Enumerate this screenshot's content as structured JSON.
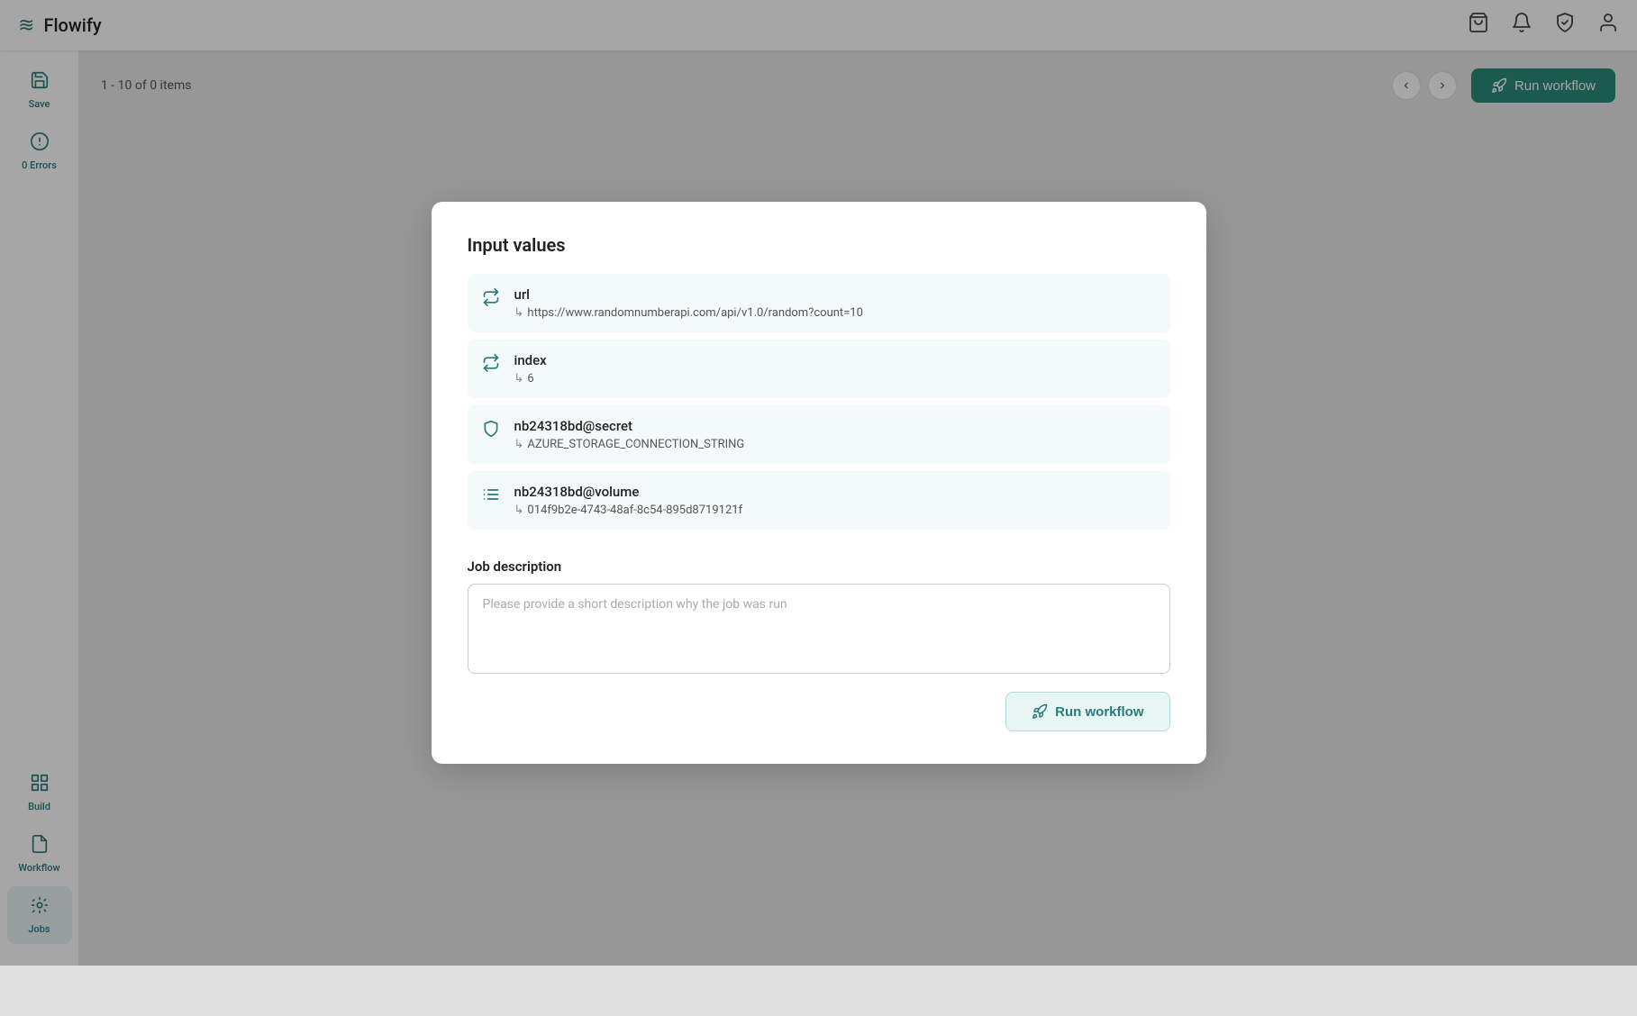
{
  "app": {
    "title": "Flowify"
  },
  "topnav": {
    "logo_icon": "≋",
    "icons": [
      "bag-icon",
      "bell-icon",
      "shield-icon",
      "user-icon"
    ]
  },
  "sidebar": {
    "items": [
      {
        "id": "save",
        "label": "Save",
        "icon": "save-icon",
        "active": false
      },
      {
        "id": "errors",
        "label": "0 Errors",
        "icon": "error-icon",
        "active": false
      },
      {
        "id": "build",
        "label": "Build",
        "icon": "build-icon",
        "active": false
      },
      {
        "id": "workflow",
        "label": "Workflow",
        "icon": "workflow-icon",
        "active": false
      },
      {
        "id": "jobs",
        "label": "Jobs",
        "icon": "jobs-icon",
        "active": true
      }
    ]
  },
  "toolbar": {
    "count_label": "1 - 10 of 0 items",
    "run_workflow_label": "Run workflow"
  },
  "modal": {
    "title": "Input values",
    "inputs": [
      {
        "id": "url",
        "name": "url",
        "icon": "arrows-icon",
        "value": "https://www.randomnumberapi.com/api/v1.0/random?count=10"
      },
      {
        "id": "index",
        "name": "index",
        "icon": "arrows-icon",
        "value": "6"
      },
      {
        "id": "secret",
        "name": "nb24318bd@secret",
        "icon": "shield-icon",
        "value": "AZURE_STORAGE_CONNECTION_STRING"
      },
      {
        "id": "volume",
        "name": "nb24318bd@volume",
        "icon": "volume-icon",
        "value": "014f9b2e-4743-48af-8c54-895d8719121f"
      }
    ],
    "job_description_label": "Job description",
    "job_description_placeholder": "Please provide a short description why the job was run",
    "run_button_label": "Run workflow"
  }
}
